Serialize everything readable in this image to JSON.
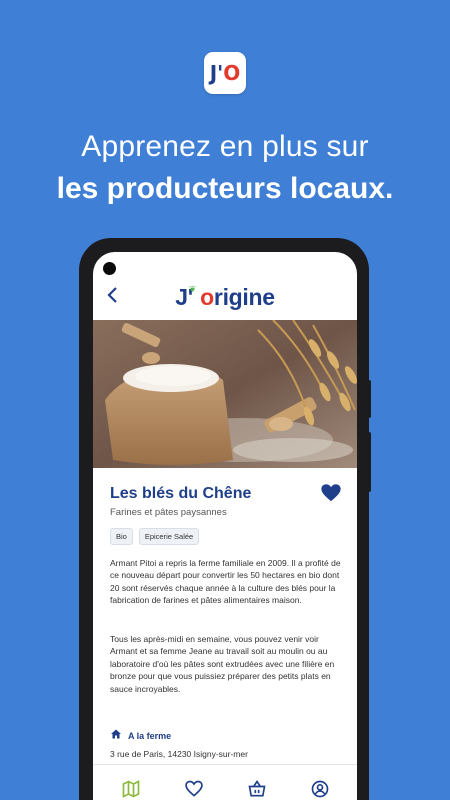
{
  "app_icon": {
    "j": "J'",
    "o": "O"
  },
  "headline": {
    "line1": "Apprenez en plus sur",
    "line2": "les producteurs locaux."
  },
  "app": {
    "brand_prefix": "J'",
    "brand_o": "o",
    "brand_suffix": "rigine",
    "back_icon": "chevron-left-icon"
  },
  "producer": {
    "name": "Les blés du Chêne",
    "subtitle": "Farines et pâtes paysannes",
    "favorite": true,
    "tags": [
      "Bio",
      "Epicerie Salée"
    ],
    "paragraph1": "Armant Pitoi a repris la ferme familiale en 2009. Il a profité de ce nouveau départ pour convertir les 50 hectares en bio dont 20 sont réservés chaque année à la culture des blés pour la fabrication de farines et pâtes alimentaires maison.",
    "paragraph2": "Tous les après-midi en semaine, vous pouvez venir voir Armant et sa femme Jeane au travail soit au moulin ou au laboratoire d'où les pâtes sont extrudées avec une filière en bronze pour que vous puissiez préparer des petits plats en sauce incroyables.",
    "farm_label": "A la ferme",
    "address": "3 rue de Paris, 14230 Isigny-sur-mer"
  },
  "nav": {
    "items": [
      "map-icon",
      "heart-icon",
      "basket-icon",
      "profile-icon"
    ],
    "active": "map-icon"
  },
  "colors": {
    "background": "#3f7fd6",
    "brand_blue": "#1f3f8a",
    "brand_red": "#e23b2e",
    "active_nav": "#8cb83b"
  }
}
